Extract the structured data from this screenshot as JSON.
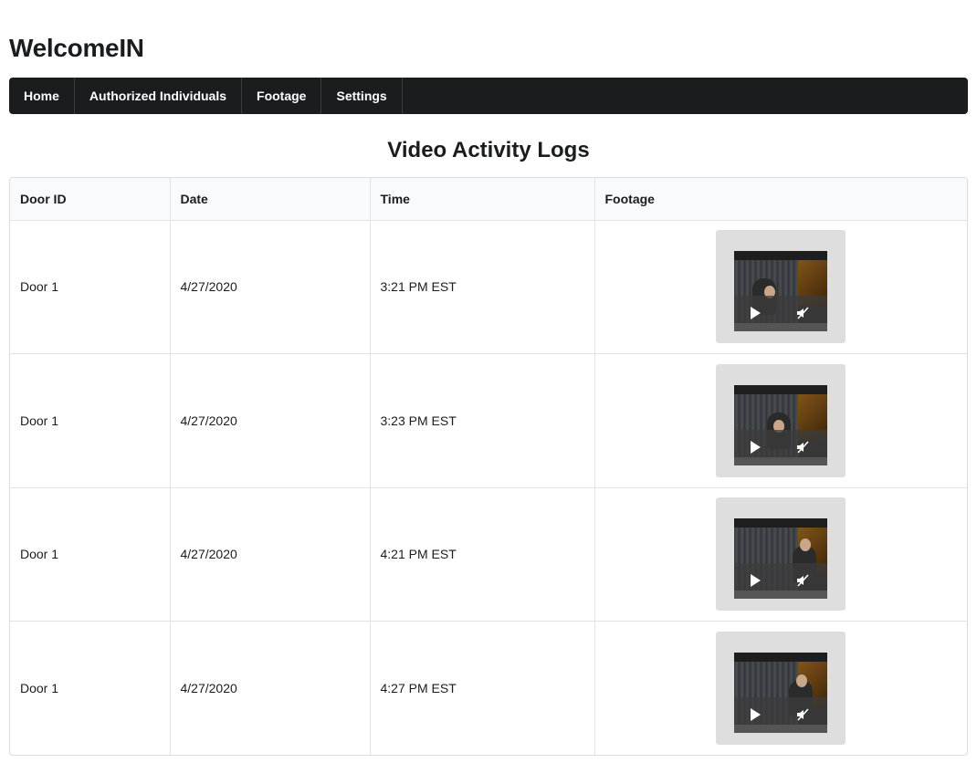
{
  "app": {
    "title": "WelcomeIN"
  },
  "nav": {
    "items": [
      {
        "label": "Home"
      },
      {
        "label": "Authorized Individuals"
      },
      {
        "label": "Footage"
      },
      {
        "label": "Settings"
      }
    ]
  },
  "main": {
    "title": "Video Activity Logs",
    "table": {
      "headers": [
        "Door ID",
        "Date",
        "Time",
        "Footage"
      ],
      "rows": [
        {
          "door": "Door 1",
          "date": "4/27/2020",
          "time": "3:21 PM EST",
          "footage_icons": [
            "play-icon",
            "mute-icon"
          ]
        },
        {
          "door": "Door 1",
          "date": "4/27/2020",
          "time": "3:23 PM EST",
          "footage_icons": [
            "play-icon",
            "mute-icon"
          ]
        },
        {
          "door": "Door 1",
          "date": "4/27/2020",
          "time": "4:21 PM EST",
          "footage_icons": [
            "play-icon",
            "mute-icon"
          ]
        },
        {
          "door": "Door 1",
          "date": "4/27/2020",
          "time": "4:27 PM EST",
          "footage_icons": [
            "play-icon",
            "mute-icon"
          ]
        }
      ]
    }
  },
  "colors": {
    "navbar_bg": "#1b1c1d",
    "nav_text": "#ffffff",
    "header_bg": "#f9fafb",
    "video_card_bg": "#dededf"
  }
}
